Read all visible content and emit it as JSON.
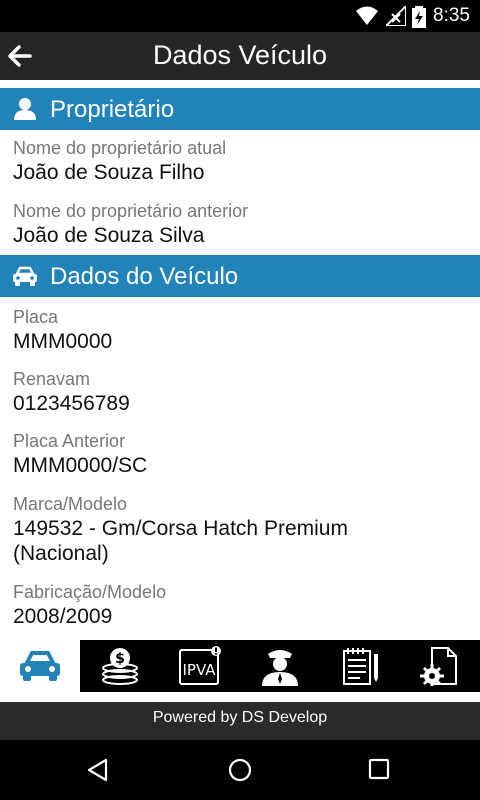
{
  "status_bar": {
    "time": "8:35"
  },
  "app_bar": {
    "title": "Dados Veículo"
  },
  "owner_section": {
    "title": "Proprietário",
    "fields": [
      {
        "label": "Nome do proprietário atual",
        "value": "João de Souza Filho"
      },
      {
        "label": "Nome do proprietário anterior",
        "value": "João de Souza Silva"
      }
    ]
  },
  "vehicle_section": {
    "title": "Dados do Veículo",
    "fields": [
      {
        "label": "Placa",
        "value": "MMM0000"
      },
      {
        "label": "Renavam",
        "value": "0123456789"
      },
      {
        "label": "Placa Anterior",
        "value": "MMM0000/SC"
      },
      {
        "label": "Marca/Modelo",
        "value": "149532 - Gm/Corsa Hatch Premium (Nacional)"
      },
      {
        "label": "Fabricação/Modelo",
        "value": "2008/2009"
      }
    ]
  },
  "tabs": [
    {
      "icon": "car-icon",
      "active": true
    },
    {
      "icon": "coins-icon",
      "active": false
    },
    {
      "icon": "ipva-icon",
      "label": "IPVA",
      "active": false
    },
    {
      "icon": "officer-icon",
      "active": false
    },
    {
      "icon": "notepad-icon",
      "active": false
    },
    {
      "icon": "settings-document-icon",
      "active": false
    }
  ],
  "footer": {
    "powered_by": "Powered by DS Develop"
  },
  "colors": {
    "section": "#2283b8",
    "app_bar": "#262626",
    "status_bar": "#000000"
  }
}
